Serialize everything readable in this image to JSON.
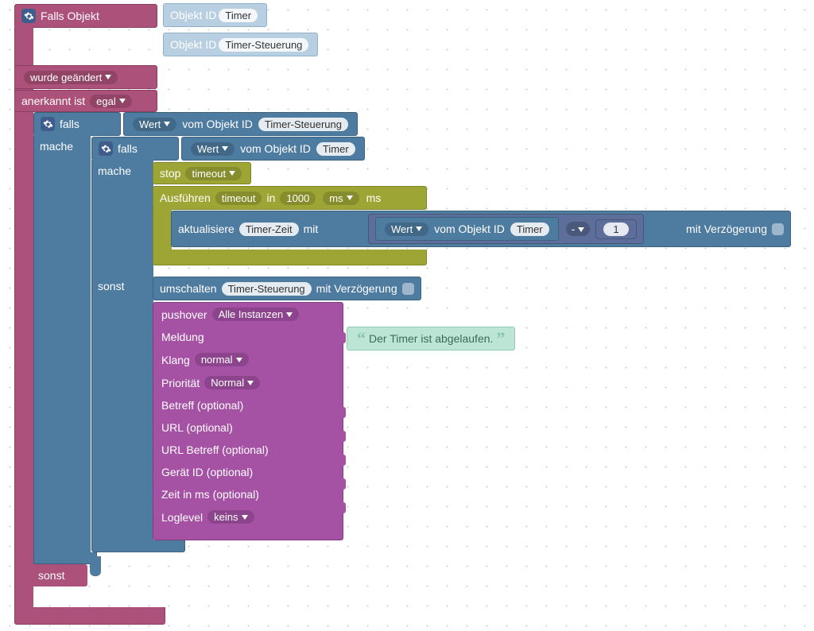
{
  "root": {
    "title": "Falls Objekt",
    "obj_id_label": "Objekt ID",
    "obj1": "Timer",
    "obj2": "Timer-Steuerung",
    "changed": "wurde geändert",
    "ack_label": "anerkannt ist",
    "ack_value": "egal",
    "sonst": "sonst"
  },
  "outerIf": {
    "falls": "falls",
    "mache": "mache",
    "sonst": "sonst",
    "wert": "Wert",
    "from_obj": "vom Objekt ID",
    "cond_obj": "Timer-Steuerung"
  },
  "innerIf": {
    "falls": "falls",
    "mache": "mache",
    "sonst": "sonst",
    "wert": "Wert",
    "from_obj": "vom Objekt ID",
    "cond_obj": "Timer"
  },
  "stop": {
    "label": "stop",
    "value": "timeout"
  },
  "exec": {
    "label": "Ausführen",
    "name": "timeout",
    "in": "in",
    "duration": "1000",
    "unit": "ms",
    "unit2": "ms"
  },
  "update": {
    "verb": "aktualisiere",
    "target": "Timer-Zeit",
    "with": "mit",
    "wert": "Wert",
    "from_obj": "vom Objekt ID",
    "src": "Timer",
    "op": "-",
    "num": "1",
    "delay_label": "mit Verzögerung"
  },
  "toggle": {
    "verb": "umschalten",
    "target": "Timer-Steuerung",
    "delay_label": "mit Verzögerung"
  },
  "pushover": {
    "label": "pushover",
    "instance": "Alle Instanzen",
    "msg_label": "Meldung",
    "msg_value": "Der Timer ist abgelaufen.",
    "sound_label": "Klang",
    "sound_value": "normal",
    "prio_label": "Priorität",
    "prio_value": "Normal",
    "subject": "Betreff (optional)",
    "url": "URL (optional)",
    "url_subject": "URL Betreff (optional)",
    "device": "Gerät ID (optional)",
    "time": "Zeit in ms (optional)",
    "log_label": "Loglevel",
    "log_value": "keins"
  }
}
